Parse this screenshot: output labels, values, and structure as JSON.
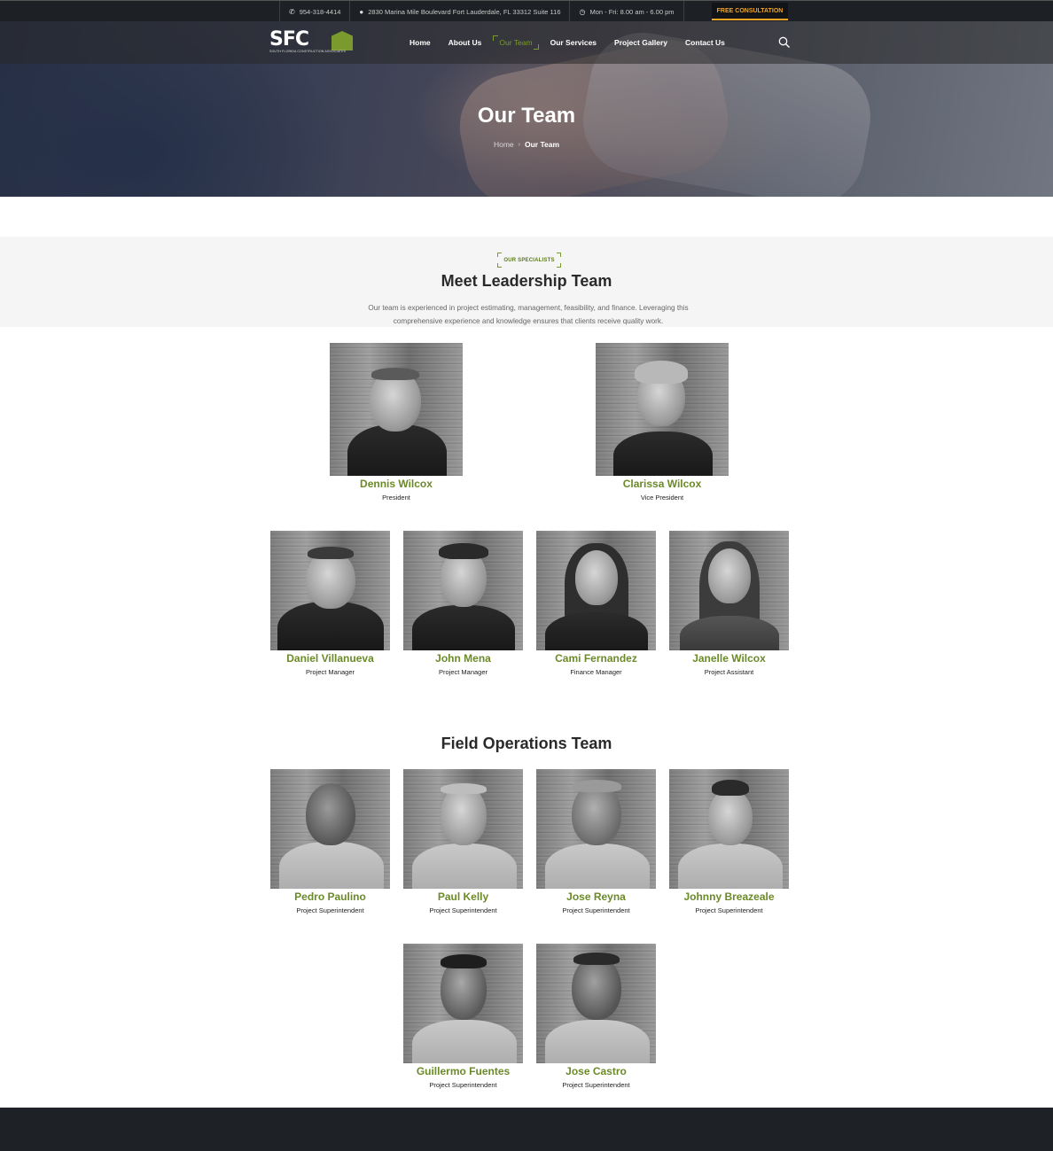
{
  "topbar": {
    "phone": "954-318-4414",
    "address": "2830 Marina Mile Boulevard Fort Lauderdale, FL 33312 Suite 116",
    "hours": "Mon - Fri: 8.00 am - 6.00 pm",
    "cta_label": "FREE CONSULTATION"
  },
  "brand": {
    "logo_text": "SFC",
    "logo_subtitle": "SOUTH FLORIDA CONSTRUCTION ASSOCIATES",
    "accent_color": "#6b8a28"
  },
  "nav": {
    "items": [
      {
        "label": "Home"
      },
      {
        "label": "About Us"
      },
      {
        "label": "Our Team"
      },
      {
        "label": "Our Services"
      },
      {
        "label": "Project Gallery"
      },
      {
        "label": "Contact Us"
      }
    ],
    "active": "Our Team",
    "search_icon": "search-icon"
  },
  "hero": {
    "title": "Our Team",
    "breadcrumb_home": "Home",
    "breadcrumb_sep": "›",
    "breadcrumb_current": "Our Team"
  },
  "intro": {
    "tag": "OUR SPECIALISTS",
    "heading": "Meet Leadership Team",
    "text": "Our team is experienced in project estimating, management, feasibility, and finance. Leveraging this comprehensive experience and knowledge ensures that clients receive quality work."
  },
  "leadership": [
    {
      "name": "Dennis Wilcox",
      "role": "President"
    },
    {
      "name": "Clarissa Wilcox",
      "role": "Vice President"
    }
  ],
  "managers": [
    {
      "name": "Daniel Villanueva",
      "role": "Project Manager"
    },
    {
      "name": "John Mena",
      "role": "Project Manager"
    },
    {
      "name": "Cami Fernandez",
      "role": "Finance Manager"
    },
    {
      "name": "Janelle Wilcox",
      "role": "Project Assistant"
    }
  ],
  "field": {
    "heading": "Field Operations Team",
    "members": [
      {
        "name": "Pedro Paulino",
        "role": "Project Superintendent"
      },
      {
        "name": "Paul Kelly",
        "role": "Project Superintendent"
      },
      {
        "name": "Jose Reyna",
        "role": "Project Superintendent"
      },
      {
        "name": "Johnny Breazeale",
        "role": "Project Superintendent"
      },
      {
        "name": "Guillermo Fuentes",
        "role": "Project Superintendent"
      },
      {
        "name": "Jose Castro",
        "role": "Project Superintendent"
      }
    ]
  }
}
